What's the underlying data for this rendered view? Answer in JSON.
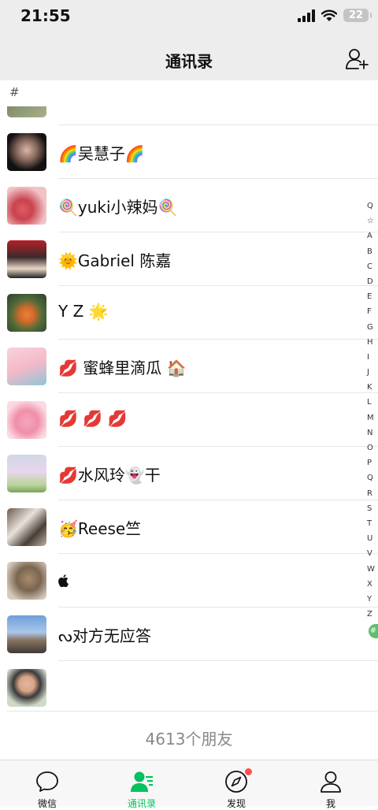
{
  "status_bar": {
    "time": "21:55",
    "battery": "22"
  },
  "nav": {
    "title": "通讯录"
  },
  "section_header": "#",
  "contacts": [
    {
      "name": "🌈吴慧子🌈"
    },
    {
      "name": "🍭yuki小辣妈🍭"
    },
    {
      "name": "🌞Gabriel 陈嘉"
    },
    {
      "name": "Y Z 🌟"
    },
    {
      "name": "💋 蜜蜂里滴瓜 🏠"
    },
    {
      "name": "💋 💋 💋"
    },
    {
      "name": "💋水风玲👻干"
    },
    {
      "name": "🥳Reese竺"
    },
    {
      "name": ""
    },
    {
      "name": "ᔓ对方无应答"
    },
    {
      "name": ""
    }
  ],
  "index_letters": [
    "Q",
    "☆",
    "A",
    "B",
    "C",
    "D",
    "E",
    "F",
    "G",
    "H",
    "I",
    "J",
    "K",
    "L",
    "M",
    "N",
    "O",
    "P",
    "Q",
    "R",
    "S",
    "T",
    "U",
    "V",
    "W",
    "X",
    "Y",
    "Z"
  ],
  "index_active": "#",
  "friend_count": "4613个朋友",
  "tabs": [
    {
      "label": "微信",
      "icon": "chat-bubble-icon"
    },
    {
      "label": "通讯录",
      "icon": "contacts-icon",
      "active": true
    },
    {
      "label": "发现",
      "icon": "compass-icon",
      "badge": true
    },
    {
      "label": "我",
      "icon": "person-icon"
    }
  ],
  "colors": {
    "accent": "#07c160",
    "badge": "#fa5151"
  }
}
